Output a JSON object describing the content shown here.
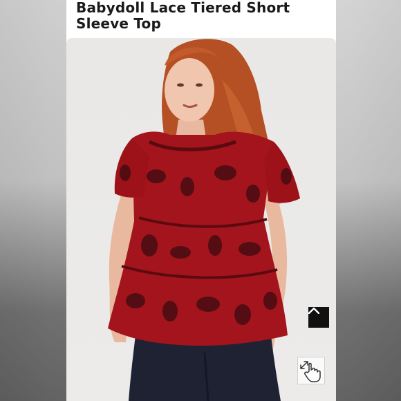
{
  "product": {
    "title": "Babydoll Lace Tiered Short Sleeve Top"
  },
  "image": {
    "alt": "Model wearing red lace tiered short sleeve top"
  },
  "controls": {
    "scroll_top_icon": "chevron-up-icon",
    "zoom_icon": "hand-pointer-expand-icon"
  },
  "colors": {
    "garment": "#a3141c",
    "lace": "#3a0b10",
    "hair": "#c25a2c",
    "jeans": "#1f2233",
    "button_dark": "#111111"
  }
}
